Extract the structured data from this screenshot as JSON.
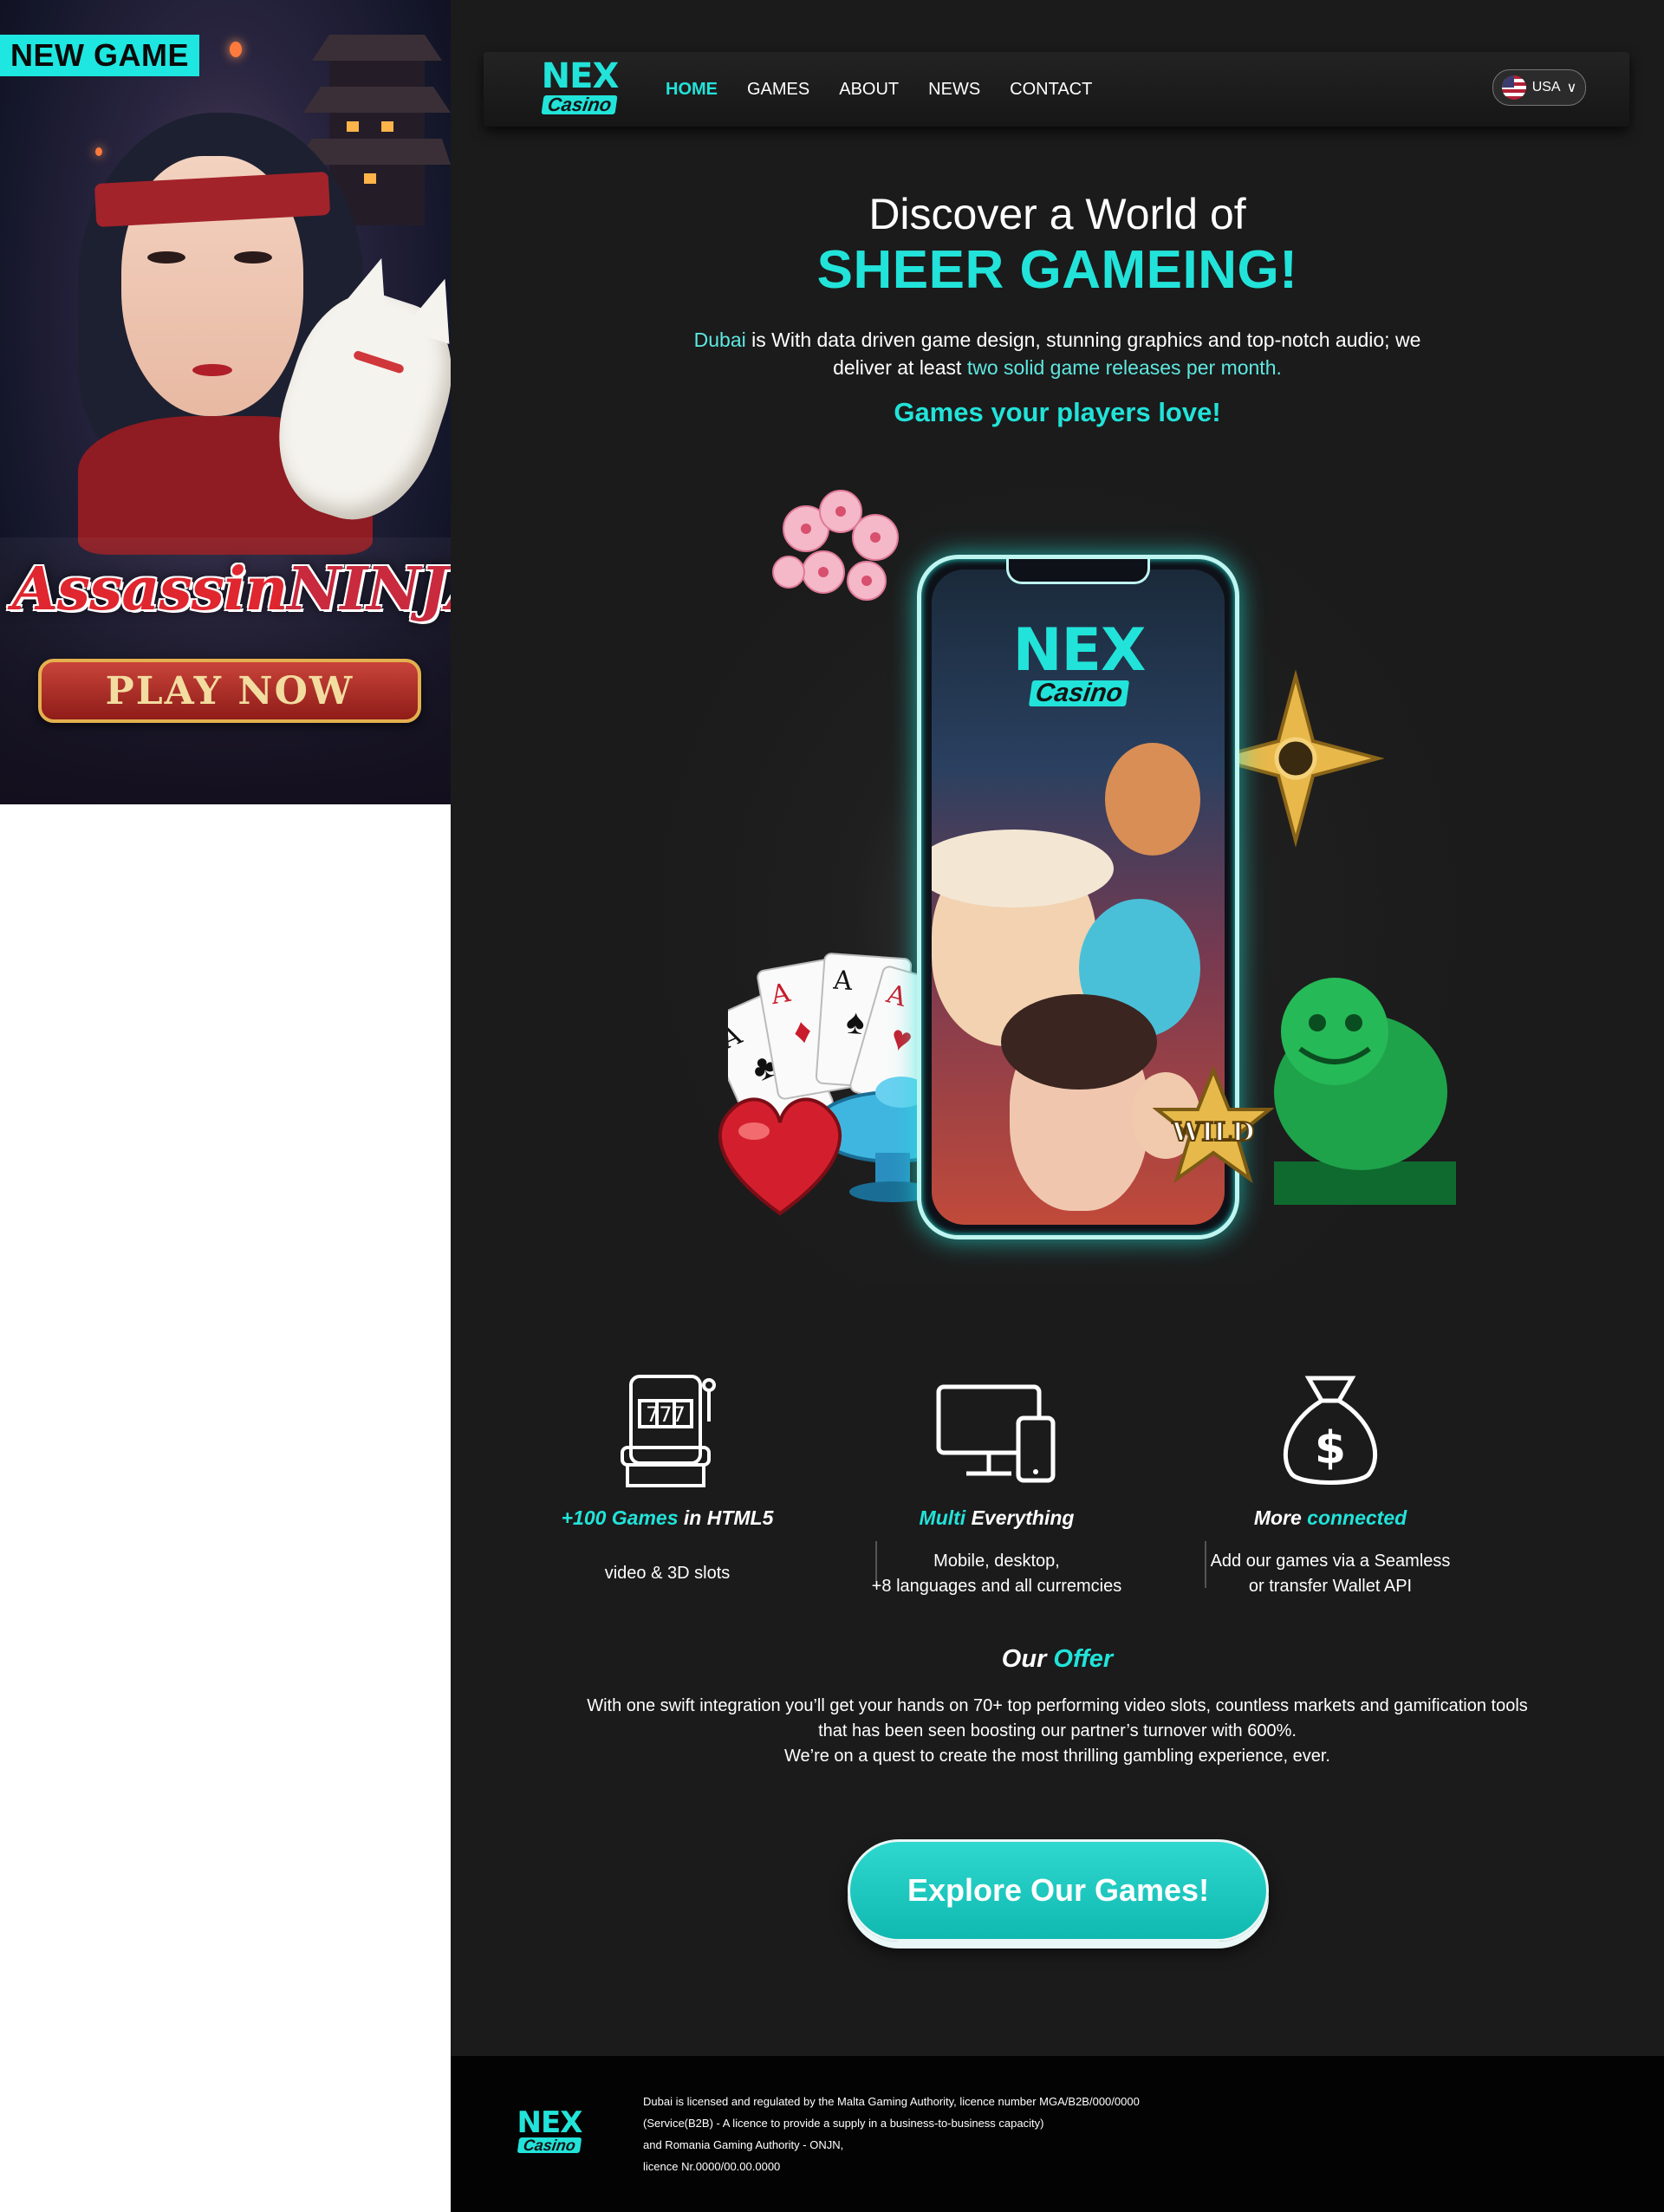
{
  "promo": {
    "tag": "NEW GAME",
    "game_title_part1": "Assassin",
    "game_title_part2": "NINJA",
    "play_button": "PLAY NOW"
  },
  "nav": {
    "logo_top": "NEX",
    "logo_bottom": "Casino",
    "links": [
      "HOME",
      "GAMES",
      "ABOUT",
      "NEWS",
      "CONTACT"
    ],
    "active_index": 0,
    "language": "USA",
    "language_chevron": "∨"
  },
  "hero": {
    "line1": "Discover a World of",
    "line2": "SHEER GAMEING!",
    "desc_hl1": "Dubai",
    "desc_mid": " is With data driven game design, stunning graphics and top-notch audio; we deliver at least ",
    "desc_hl2": "two solid game releases per month.",
    "tagline": "Games your players love!",
    "phone_logo_top": "NEX",
    "phone_logo_bottom": "Casino",
    "wild_label": "WILD"
  },
  "features": [
    {
      "title_cyan": "+100 Games",
      "title_white": " in HTML5",
      "desc": "video & 3D slots",
      "icon": "slot-machine-icon"
    },
    {
      "title_cyan": "Multi",
      "title_white": " Everything",
      "desc_line1": "Mobile, desktop,",
      "desc_line2": "+8 languages and all curremcies",
      "icon": "devices-icon"
    },
    {
      "title_white": "More ",
      "title_cyan": "connected",
      "desc_line1": "Add our games via a Seamless",
      "desc_line2": "or transfer Wallet API",
      "icon": "money-bag-icon"
    }
  ],
  "offer": {
    "title_white": "Our ",
    "title_cyan": "Offer",
    "line1": "With one swift integration you’ll get your hands on 70+ top performing video slots, countless markets and gamification tools",
    "line2": "that has been seen boosting our partner’s turnover with 600%.",
    "line3": "We’re on a quest to create the most thrilling gambling experience, ever."
  },
  "cta": {
    "label": "Explore Our Games!"
  },
  "footer": {
    "logo_top": "NEX",
    "logo_bottom": "Casino",
    "lines": [
      "Dubai is licensed and regulated by the Malta Gaming Authority, licence number MGA/B2B/000/0000",
      "(Service(B2B) - A licence to provide a supply in a business-to-business capacity)",
      "and Romania Gaming Authority - ONJN,",
      "licence Nr.0000/00.00.0000"
    ]
  },
  "colors": {
    "accent": "#22e3d9",
    "background": "#1b1b1b",
    "footer_bg": "#030303",
    "promo_tag": "#1ee6e0"
  }
}
